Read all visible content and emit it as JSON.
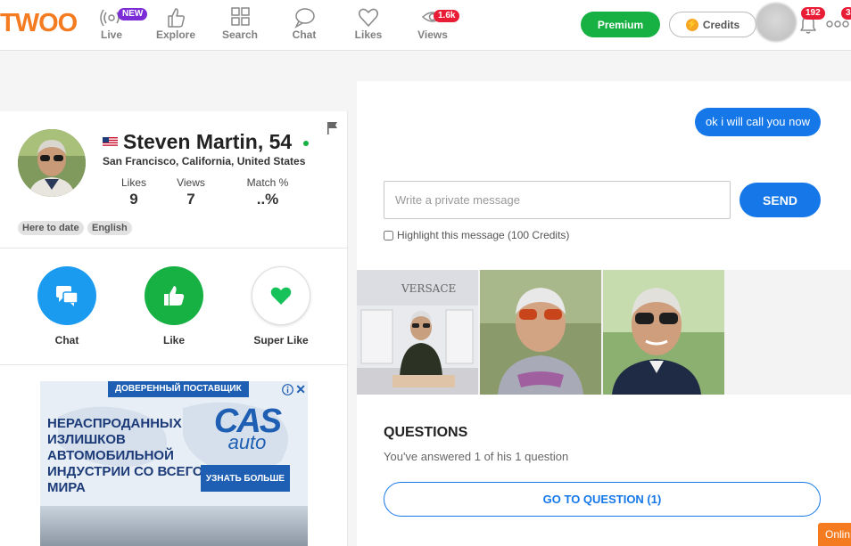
{
  "brand": {
    "logo_text": "TWOO",
    "accent": "#f47b20"
  },
  "nav": {
    "items": [
      {
        "label": "Live",
        "icon": "live-icon",
        "badge": "NEW"
      },
      {
        "label": "Explore",
        "icon": "thumbs-up-icon"
      },
      {
        "label": "Search",
        "icon": "grid-icon"
      },
      {
        "label": "Chat",
        "icon": "chat-bubble-icon"
      },
      {
        "label": "Likes",
        "icon": "heart-icon"
      },
      {
        "label": "Views",
        "icon": "eye-icon",
        "badge": "1.6k"
      }
    ],
    "premium_label": "Premium",
    "credits_label": "Credits",
    "notifications_badge": "192",
    "more_badge": "3"
  },
  "profile": {
    "name_age": "Steven Martin, 54",
    "location": "San Francisco, California, United States",
    "online": true,
    "stats": [
      {
        "label": "Likes",
        "value": "9"
      },
      {
        "label": "Views",
        "value": "7"
      },
      {
        "label": "Match %",
        "value": "..%"
      }
    ],
    "tags": [
      "Here to date",
      "English"
    ],
    "actions": [
      {
        "label": "Chat",
        "color": "#1a9bf0"
      },
      {
        "label": "Like",
        "color": "#17b043"
      },
      {
        "label": "Super Like",
        "color": "#17c25a"
      }
    ]
  },
  "ad": {
    "top_label": "ДОВЕРЕННЫЙ ПОСТАВЩИК",
    "headline": "НЕРАСПРОДАННЫХ ИЗЛИШКОВ АВТОМОБИЛЬНОЙ ИНДУСТРИИ СО ВСЕГО МИРА",
    "brand_top": "CAS",
    "brand_bottom": "auto",
    "cta": "УЗНАТЬ БОЛЬШЕ",
    "close_label": "✕"
  },
  "chat": {
    "last_message": "ok i will call you now",
    "input_placeholder": "Write a private message",
    "send_label": "SEND",
    "highlight_label": "Highlight this message (100 Credits)"
  },
  "photos": [
    {
      "desc_icon": "photo-store-icon",
      "sign": "VERSACE"
    },
    {
      "desc_icon": "photo-selfie-sunglasses-icon"
    },
    {
      "desc_icon": "photo-selfie-trees-icon"
    }
  ],
  "questions": {
    "title": "QUESTIONS",
    "subtitle": "You've answered 1 of his 1 question",
    "button": "GO TO QUESTION (1)"
  },
  "online_tab": "Onlin"
}
